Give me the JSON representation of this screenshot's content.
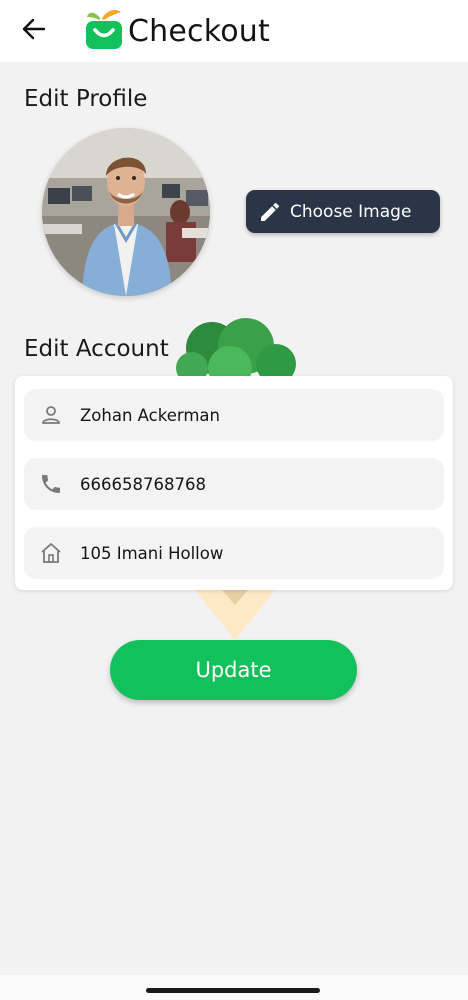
{
  "header": {
    "back_icon": "arrow-left-icon",
    "logo_icon": "shopping-basket-logo",
    "brand": "Checkout",
    "brand_color": "#12c15b"
  },
  "profile": {
    "title": "Edit Profile",
    "avatar_alt": "profile photo",
    "choose_image_label": "Choose Image",
    "choose_image_icon": "pencil-icon"
  },
  "account": {
    "title": "Edit Account",
    "fields": [
      {
        "icon": "person-icon",
        "value": "Zohan Ackerman"
      },
      {
        "icon": "phone-icon",
        "value": "666658768768"
      },
      {
        "icon": "home-icon",
        "value": "105 Imani Hollow"
      }
    ]
  },
  "actions": {
    "update_label": "Update",
    "update_color": "#12c15b"
  },
  "colors": {
    "background": "#f2f2f2",
    "button_dark": "#2a3547"
  }
}
